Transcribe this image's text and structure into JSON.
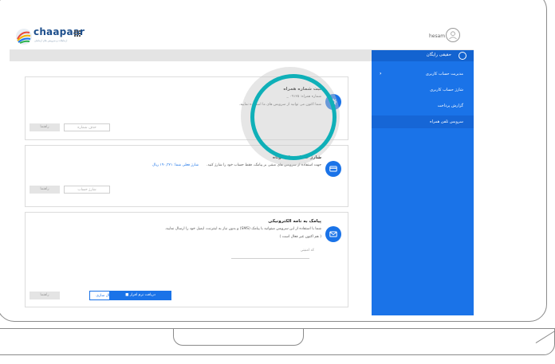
{
  "header": {
    "brand": "chaapaar",
    "tagline": "ارتباطات و سرویس های ارتباطی",
    "username": "hesam"
  },
  "sidebar": {
    "account_type": "حقیقی رایگان",
    "items": [
      {
        "label": "مدیریت حساب کاربری"
      },
      {
        "label": "شارژ حساب کاربری"
      },
      {
        "label": "گزارش پرداخت"
      },
      {
        "label": "سرویس تلفن همراه"
      }
    ],
    "chevron": "‹"
  },
  "cards": {
    "phone": {
      "title": "ثبت شماره همراه",
      "number_label": "شماره همراه:",
      "number_value": "۰۹۱۲۵ _",
      "desc": "شما اکنون می توانید از سرویس های ما استفاده نمایید.",
      "delete_label": "حذف شماره",
      "help_label": "راهنما"
    },
    "sms": {
      "title": "شارژ حساب پیام کوتاه",
      "desc": "جهت استفاده از سرویس های مبتنی بر پیامک، فقط حساب خود را شارژ کنید.",
      "balance": "شارژ فعلی شما: ۱۹۰,۳۲۱ ریال",
      "charge_label": "شارژ حساب",
      "help_label": "راهنما"
    },
    "email": {
      "title": "پیامک به نامه الکترونیکی",
      "desc": "شما با استفاده از این سرویس میتوانید با پیامک (SMS) و بدون نیاز به اینترنت، ایمیل خود را ارسال نمایید.",
      "status": "( هم اکنون غیر فعال است )",
      "placeholder": "کد امنیتی",
      "download_label": "دریافت نرم افزار",
      "activate_label": "فعال سازی",
      "help_label": "راهنما"
    }
  },
  "colors": {
    "accent": "#1a73e8",
    "highlight": "#0fb0b8"
  },
  "icons": [
    "grid-icon",
    "user-icon",
    "gear-icon",
    "card-icon",
    "envelope-icon",
    "android-icon"
  ]
}
